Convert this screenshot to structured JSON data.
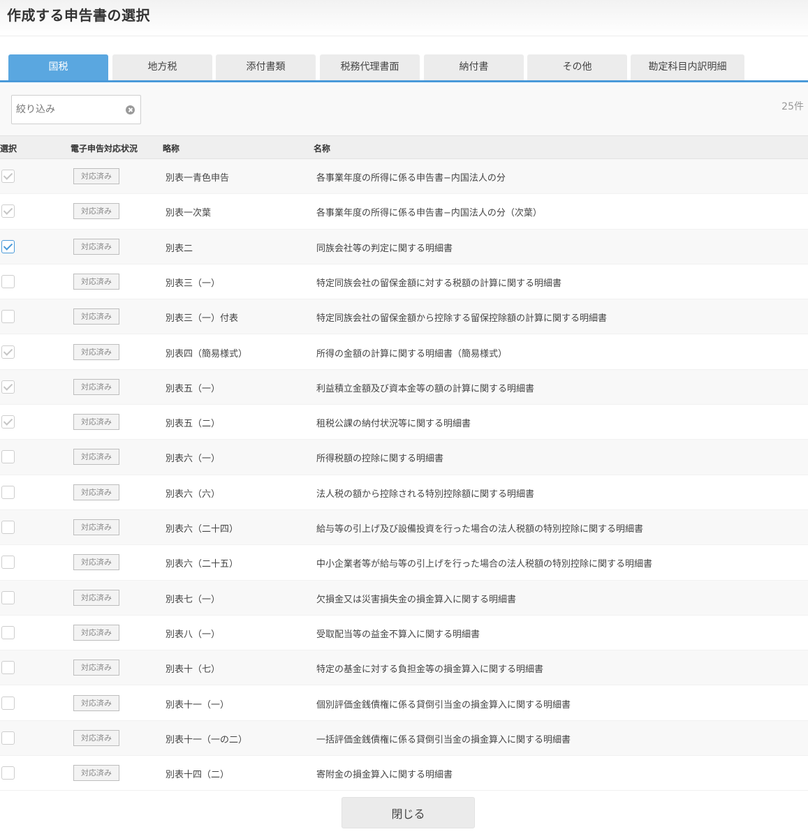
{
  "header": {
    "title": "作成する申告書の選択"
  },
  "tabs": [
    {
      "label": "国税",
      "active": true
    },
    {
      "label": "地方税",
      "active": false
    },
    {
      "label": "添付書類",
      "active": false
    },
    {
      "label": "税務代理書面",
      "active": false
    },
    {
      "label": "納付書",
      "active": false
    },
    {
      "label": "その他",
      "active": false
    },
    {
      "label": "勘定科目内訳明細",
      "active": false
    }
  ],
  "filter": {
    "placeholder": "絞り込み",
    "value": ""
  },
  "count_text": "25件",
  "columns": {
    "select": "選択",
    "status": "電子申告対応状況",
    "abbr": "略称",
    "name": "名称"
  },
  "rows": [
    {
      "checked": true,
      "checked_active": false,
      "status": "対応済み",
      "abbr": "別表一青色申告",
      "name": "各事業年度の所得に係る申告書−内国法人の分"
    },
    {
      "checked": true,
      "checked_active": false,
      "status": "対応済み",
      "abbr": "別表一次葉",
      "name": "各事業年度の所得に係る申告書−内国法人の分（次葉）"
    },
    {
      "checked": true,
      "checked_active": true,
      "status": "対応済み",
      "abbr": "別表二",
      "name": "同族会社等の判定に関する明細書"
    },
    {
      "checked": false,
      "checked_active": false,
      "status": "対応済み",
      "abbr": "別表三（一）",
      "name": "特定同族会社の留保金額に対する税額の計算に関する明細書"
    },
    {
      "checked": false,
      "checked_active": false,
      "status": "対応済み",
      "abbr": "別表三（一）付表",
      "name": "特定同族会社の留保金額から控除する留保控除額の計算に関する明細書"
    },
    {
      "checked": true,
      "checked_active": false,
      "status": "対応済み",
      "abbr": "別表四（簡易様式）",
      "name": "所得の金額の計算に関する明細書（簡易様式）"
    },
    {
      "checked": true,
      "checked_active": false,
      "status": "対応済み",
      "abbr": "別表五（一）",
      "name": "利益積立金額及び資本金等の額の計算に関する明細書"
    },
    {
      "checked": true,
      "checked_active": false,
      "status": "対応済み",
      "abbr": "別表五（二）",
      "name": "租税公課の納付状況等に関する明細書"
    },
    {
      "checked": false,
      "checked_active": false,
      "status": "対応済み",
      "abbr": "別表六（一）",
      "name": "所得税額の控除に関する明細書"
    },
    {
      "checked": false,
      "checked_active": false,
      "status": "対応済み",
      "abbr": "別表六（六）",
      "name": "法人税の額から控除される特別控除額に関する明細書"
    },
    {
      "checked": false,
      "checked_active": false,
      "status": "対応済み",
      "abbr": "別表六（二十四）",
      "name": "給与等の引上げ及び設備投資を行った場合の法人税額の特別控除に関する明細書"
    },
    {
      "checked": false,
      "checked_active": false,
      "status": "対応済み",
      "abbr": "別表六（二十五）",
      "name": "中小企業者等が給与等の引上げを行った場合の法人税額の特別控除に関する明細書"
    },
    {
      "checked": false,
      "checked_active": false,
      "status": "対応済み",
      "abbr": "別表七（一）",
      "name": "欠損金又は災害損失金の損金算入に関する明細書"
    },
    {
      "checked": false,
      "checked_active": false,
      "status": "対応済み",
      "abbr": "別表八（一）",
      "name": "受取配当等の益金不算入に関する明細書"
    },
    {
      "checked": false,
      "checked_active": false,
      "status": "対応済み",
      "abbr": "別表十（七）",
      "name": "特定の基金に対する負担金等の損金算入に関する明細書"
    },
    {
      "checked": false,
      "checked_active": false,
      "status": "対応済み",
      "abbr": "別表十一（一）",
      "name": "個別評価金銭債権に係る貸倒引当金の損金算入に関する明細書"
    },
    {
      "checked": false,
      "checked_active": false,
      "status": "対応済み",
      "abbr": "別表十一（一の二）",
      "name": "一括評価金銭債権に係る貸倒引当金の損金算入に関する明細書"
    },
    {
      "checked": false,
      "checked_active": false,
      "status": "対応済み",
      "abbr": "別表十四（二）",
      "name": "寄附金の損金算入に関する明細書"
    }
  ],
  "footer": {
    "close_label": "閉じる"
  }
}
